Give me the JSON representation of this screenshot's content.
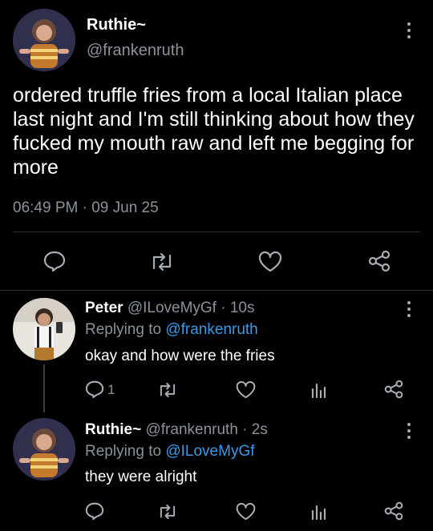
{
  "main_tweet": {
    "display_name": "Ruthie~",
    "handle": "@frankenruth",
    "text": "ordered truffle fries from a local Italian place last night and I'm still thinking about how they fucked my mouth raw and left me begging for more",
    "time": "06:49 PM",
    "separator": "·",
    "date": "09 Jun 25"
  },
  "replies": [
    {
      "display_name": "Peter",
      "handle_meta": "@ILoveMyGf · 10s",
      "replying_prefix": "Replying to",
      "replying_to": "@frankenruth",
      "text": "okay and how were the fries",
      "reply_count": "1"
    },
    {
      "display_name": "Ruthie~",
      "handle_meta": "@frankenruth · 2s",
      "replying_prefix": "Replying to",
      "replying_to": "@ILoveMyGf",
      "text": "they were alright",
      "reply_count": ""
    }
  ],
  "icons": [
    "reply-icon",
    "retweet-icon",
    "like-icon",
    "share-icon",
    "analytics-icon",
    "more-icon"
  ],
  "colors": {
    "background": "#000000",
    "muted": "#8b9299",
    "link": "#3b9ae8"
  }
}
